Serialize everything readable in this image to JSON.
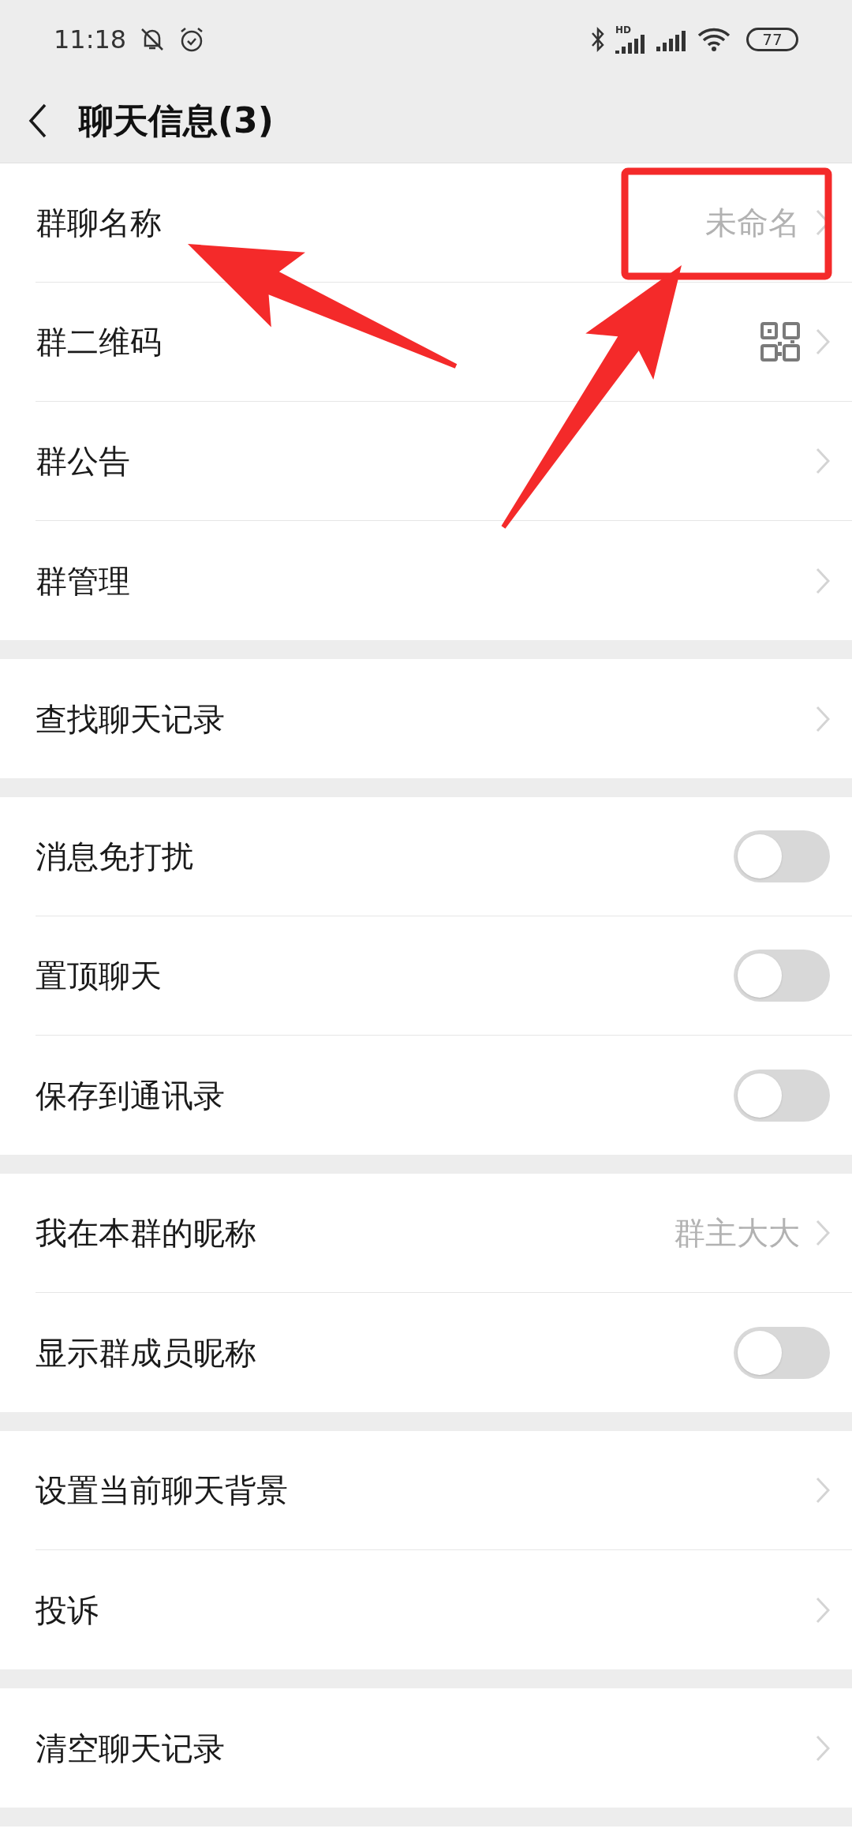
{
  "status_bar": {
    "time": "11:18",
    "battery": "77",
    "network": "HD"
  },
  "header": {
    "title": "聊天信息(3)"
  },
  "groups": [
    [
      {
        "kind": "link",
        "label": "群聊名称",
        "value": "未命名"
      },
      {
        "kind": "qr",
        "label": "群二维码"
      },
      {
        "kind": "link",
        "label": "群公告"
      },
      {
        "kind": "link",
        "label": "群管理"
      }
    ],
    [
      {
        "kind": "link",
        "label": "查找聊天记录"
      }
    ],
    [
      {
        "kind": "toggle",
        "label": "消息免打扰",
        "on": false
      },
      {
        "kind": "toggle",
        "label": "置顶聊天",
        "on": false
      },
      {
        "kind": "toggle",
        "label": "保存到通讯录",
        "on": false
      }
    ],
    [
      {
        "kind": "link",
        "label": "我在本群的昵称",
        "value": "群主大大"
      },
      {
        "kind": "toggle",
        "label": "显示群成员昵称",
        "on": false
      }
    ],
    [
      {
        "kind": "link",
        "label": "设置当前聊天背景"
      },
      {
        "kind": "link",
        "label": "投诉"
      }
    ],
    [
      {
        "kind": "link",
        "label": "清空聊天记录"
      }
    ]
  ]
}
